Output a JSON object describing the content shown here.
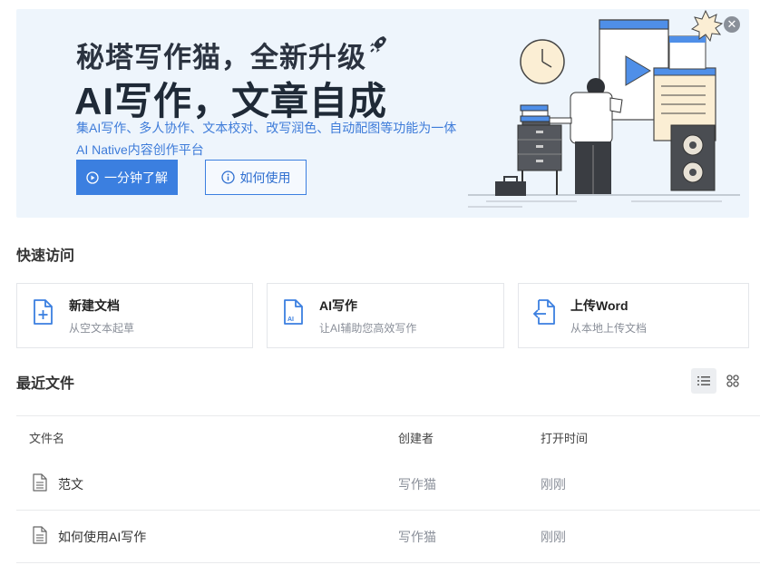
{
  "banner": {
    "headline_line1": "秘塔写作猫，全新升级",
    "headline_line2": "AI写作，文章自成",
    "description_line1": "集AI写作、多人协作、文本校对、改写润色、自动配图等功能为一体",
    "description_line2": "AI Native内容创作平台",
    "primary_button": "一分钟了解",
    "secondary_button": "如何使用",
    "close_icon": "close-icon",
    "accent_color": "#3b7fe0",
    "background_color": "#eef5fc"
  },
  "quick_access": {
    "title": "快速访问",
    "cards": [
      {
        "title": "新建文档",
        "subtitle": "从空文本起草",
        "icon": "new-document-icon"
      },
      {
        "title": "AI写作",
        "subtitle": "让AI辅助您高效写作",
        "icon": "ai-document-icon",
        "icon_text": "AI"
      },
      {
        "title": "上传Word",
        "subtitle": "从本地上传文档",
        "icon": "upload-document-icon"
      }
    ]
  },
  "recent_files": {
    "title": "最近文件",
    "view_modes": [
      "list-view-icon",
      "grid-view-icon"
    ],
    "active_view": "list",
    "columns": {
      "name": "文件名",
      "creator": "创建者",
      "time": "打开时间"
    },
    "rows": [
      {
        "name": "范文",
        "creator": "写作猫",
        "time": "刚刚"
      },
      {
        "name": "如何使用AI写作",
        "creator": "写作猫",
        "time": "刚刚"
      }
    ]
  }
}
